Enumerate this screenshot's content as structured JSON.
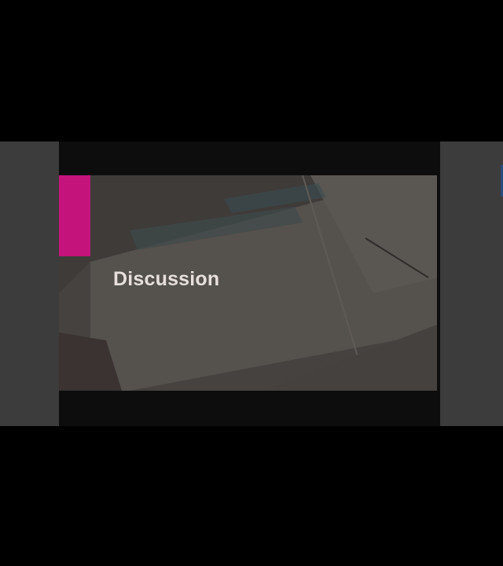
{
  "slide": {
    "title": "Discussion"
  },
  "colors": {
    "background": "#000000",
    "side_panel": "#3c3c3c",
    "slide_frame": "#0d0d0d",
    "accent": "#c4147c",
    "title_text": "#e6dfdc"
  }
}
